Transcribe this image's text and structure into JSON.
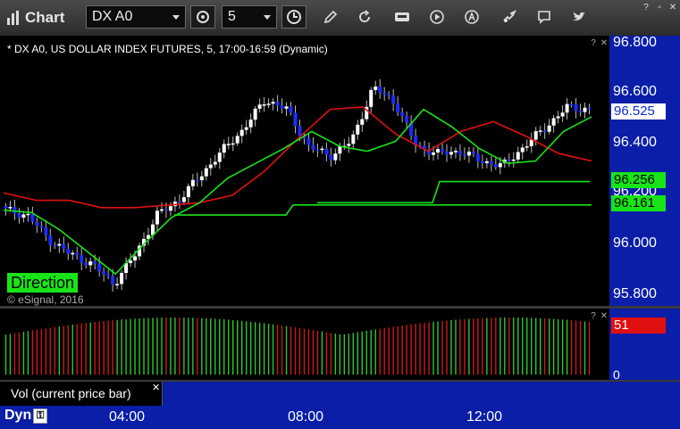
{
  "app": {
    "title": "Chart"
  },
  "toolbar": {
    "symbol": "DX A0",
    "interval": "5"
  },
  "chart": {
    "title": "* DX A0, US DOLLAR INDEX FUTURES, 5, 17:00-16:59 (Dynamic)",
    "direction_label": "Direction",
    "copyright": "© eSignal, 2016",
    "price_labels": [
      "96.800",
      "96.600",
      "96.400",
      "96.200",
      "96.000",
      "95.800"
    ],
    "last_price": "96.525",
    "level_upper": "96.256",
    "level_lower": "96.161",
    "volume_value": "51",
    "volume_zero": "0",
    "time_labels": [
      "04:00",
      "08:00",
      "12:00"
    ],
    "study_label": "Vol (current price bar)",
    "dyn_label": "Dyn",
    "colors": {
      "axis_bg": "#0a1ea8",
      "up": "#ffffff",
      "down": "#1a2cff",
      "ma_fast": "#e01010",
      "ma_slow": "#18e418"
    }
  },
  "chart_data": {
    "type": "line",
    "title": "* DX A0, US DOLLAR INDEX FUTURES, 5, 17:00-16:59 (Dynamic)",
    "ylim": [
      95.75,
      96.85
    ],
    "x": [
      "04:00",
      "08:00",
      "12:00"
    ],
    "series": [
      {
        "values": [
          96.14,
          96.12,
          96.02,
          95.96,
          95.92,
          95.84,
          95.96,
          96.12,
          96.18,
          96.28,
          96.38,
          96.47,
          96.59,
          96.55,
          96.4,
          96.36,
          96.42,
          96.64,
          96.58,
          96.4,
          96.37,
          96.38,
          96.34,
          96.32,
          96.4,
          96.48,
          96.56,
          96.55
        ]
      },
      {
        "values": [
          96.21,
          96.18,
          96.18,
          96.15,
          96.15,
          96.16,
          96.17,
          96.2,
          96.3,
          96.43,
          96.55,
          96.56,
          96.45,
          96.38,
          96.46,
          96.5,
          96.44,
          96.37,
          96.34
        ]
      },
      {
        "values": [
          96.14,
          96.13,
          96.06,
          95.97,
          95.88,
          96.0,
          96.11,
          96.17,
          96.27,
          96.33,
          96.39,
          96.46,
          96.4,
          96.38,
          96.42,
          96.55,
          96.48,
          96.39,
          96.33,
          96.34,
          96.46,
          96.52
        ]
      },
      {
        "values": [
          96.256
        ]
      },
      {
        "values": [
          96.161
        ]
      }
    ]
  }
}
